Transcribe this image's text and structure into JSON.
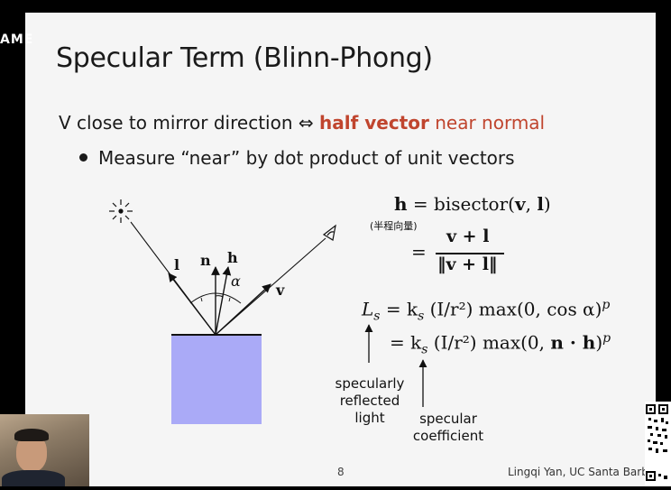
{
  "overlay_text": "AME",
  "slide": {
    "title": "Specular Term (Blinn-Phong)",
    "line1": {
      "before": "V close to mirror direction ⇔ ",
      "highlight": "half vector",
      "after": " near normal"
    },
    "bullet": "Measure “near” by dot product of unit vectors",
    "diagram_labels": {
      "l": "l",
      "n": "n",
      "h": "h",
      "v": "v",
      "alpha": "α"
    },
    "equations": {
      "eq1_lhs": "h",
      "eq1_rhs": "= bisector(",
      "eq1_v": "v",
      "eq1_comma": ", ",
      "eq1_l": "l",
      "eq1_close": ")",
      "half_vector_note": "(半程向量)",
      "eq2_eq": "=",
      "eq2_num": "v + l",
      "eq2_den": "‖v + l‖",
      "eq3_lhs": "L",
      "eq3_lhs_sub": "s",
      "eq3_rhs": "= k",
      "eq3_ks_sub": "s",
      "eq3_tail": " (I/r²) max(0, cos α)",
      "eq3_p": "p",
      "eq4_rhs": "= k",
      "eq4_ks_sub": "s",
      "eq4_tail": " (I/r²) max(0, ",
      "eq4_nh": "n · h",
      "eq4_close": ")",
      "eq4_p": "p"
    },
    "annotations": {
      "specularly_reflected_light": [
        "specularly",
        "reflected",
        "light"
      ],
      "specular_coefficient": [
        "specular",
        "coefficient"
      ]
    },
    "page_number": "8",
    "credit": "Lingqi Yan, UC Santa Barbar"
  },
  "colors": {
    "accent": "#c0452e",
    "surface": "#aaaaf7",
    "slide_bg": "#f5f5f5"
  }
}
